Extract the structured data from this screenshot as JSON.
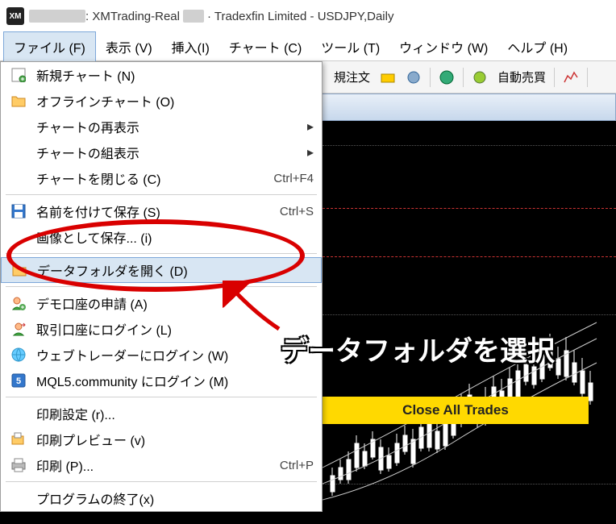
{
  "titlebar": {
    "prefix": ": XMTrading-Real",
    "suffix": "· Tradexfin Limited - USDJPY,Daily"
  },
  "menubar": {
    "file": "ファイル (F)",
    "view": "表示 (V)",
    "insert": "挿入(I)",
    "chart": "チャート (C)",
    "tool": "ツール (T)",
    "window": "ウィンドウ (W)",
    "help": "ヘルプ (H)"
  },
  "toolbar": {
    "new_order": "規注文",
    "auto_trade": "自動売買"
  },
  "dropdown": {
    "new_chart": "新規チャート (N)",
    "offline_chart": "オフラインチャート (O)",
    "chart_redisplay": "チャートの再表示",
    "chart_group": "チャートの組表示",
    "close_chart": "チャートを閉じる (C)",
    "close_chart_sc": "Ctrl+F4",
    "save_as": "名前を付けて保存 (S)",
    "save_as_sc": "Ctrl+S",
    "save_image": "画像として保存... (i)",
    "open_data_folder": "データフォルダを開く (D)",
    "demo_account": "デモ口座の申請 (A)",
    "login_account": "取引口座にログイン (L)",
    "webtrader_login": "ウェブトレーダーにログイン (W)",
    "mql5_login": "MQL5.community にログイン (M)",
    "print_setup": "印刷設定 (r)...",
    "print_preview": "印刷プレビュー (v)",
    "print": "印刷 (P)...",
    "print_sc": "Ctrl+P",
    "exit": "プログラムの終了(x)"
  },
  "annotation": {
    "text": "データフォルダを選択"
  },
  "banner": {
    "text": "Close All Trades"
  }
}
